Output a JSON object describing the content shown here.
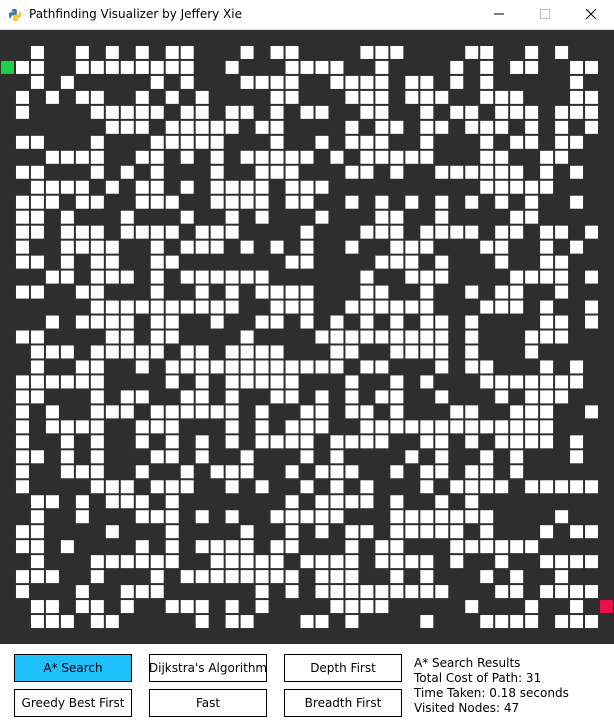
{
  "window": {
    "title": "Pathfinding Visualizer by Jeffery Xie"
  },
  "buttons": {
    "astar": "A* Search",
    "dijkstra": "Dijkstra's Algorithm",
    "depth_first": "Depth First",
    "greedy": "Greedy Best First",
    "fast": "Fast",
    "breadth_first": "Breadth First"
  },
  "active_button": "astar",
  "results": {
    "heading": "A* Search Results",
    "cost_line": "Total Cost of Path: 31",
    "time_line": "Time Taken: 0.18 seconds",
    "visited_line": "Visited Nodes: 47"
  },
  "grid": {
    "rows": 41,
    "cols": 41,
    "start": {
      "row": 2,
      "col": 0
    },
    "end": {
      "row": 38,
      "col": 40
    },
    "wall_density": 0.47
  },
  "colors": {
    "wall": "#2e2e2e",
    "open": "#ffffff",
    "start": "#1fcf4a",
    "end": "#e8114b",
    "active_button": "#1ec1fb"
  },
  "icons": {
    "app": "python-icon",
    "minimize": "minimize-icon",
    "maximize": "maximize-icon",
    "close": "close-icon"
  }
}
